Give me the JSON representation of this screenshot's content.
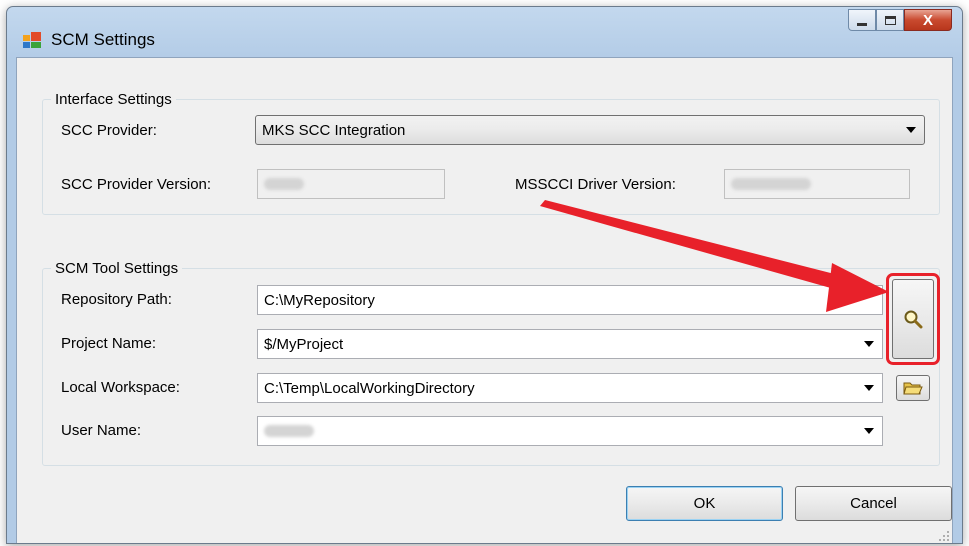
{
  "window": {
    "title": "SCM Settings",
    "close_glyph": "X"
  },
  "interface_settings": {
    "legend": "Interface Settings",
    "scc_provider_label": "SCC Provider:",
    "scc_provider_value": "MKS SCC Integration",
    "scc_provider_version_label": "SCC Provider Version:",
    "msscci_driver_version_label": "MSSCCI Driver Version:"
  },
  "scm_tool_settings": {
    "legend": "SCM Tool Settings",
    "repository_path_label": "Repository Path:",
    "repository_path_value": "C:\\MyRepository",
    "project_name_label": "Project Name:",
    "project_name_value": "$/MyProject",
    "local_workspace_label": "Local Workspace:",
    "local_workspace_value": "C:\\Temp\\LocalWorkingDirectory",
    "user_name_label": "User Name:"
  },
  "buttons": {
    "ok": "OK",
    "cancel": "Cancel"
  },
  "icons": {
    "app": "window-settings-icon",
    "browse_repository": "magnifier-icon",
    "browse_folder": "open-folder-icon"
  },
  "colors": {
    "annotation": "#e8212a",
    "titlebar": "#c3d8ee",
    "client": "#f0f0f0"
  }
}
